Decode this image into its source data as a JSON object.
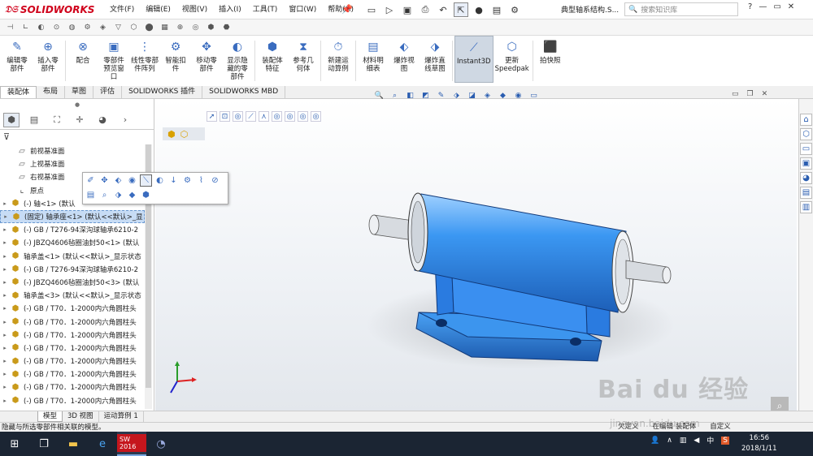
{
  "app": {
    "brand": "SOLIDWORKS",
    "doc_title": "典型轴系结构.S..."
  },
  "menu": [
    "文件(F)",
    "编辑(E)",
    "视图(V)",
    "插入(I)",
    "工具(T)",
    "窗口(W)",
    "帮助(H)"
  ],
  "search": {
    "placeholder": "搜索知识库"
  },
  "ribbon": [
    {
      "label": "编辑零\n部件",
      "icon": "edit-component-icon"
    },
    {
      "label": "插入零\n部件",
      "icon": "insert-component-icon"
    },
    {
      "label": "配合",
      "icon": "mate-icon"
    },
    {
      "label": "零部件\n预览窗\n口",
      "icon": "component-preview-icon"
    },
    {
      "label": "线性零部\n件阵列",
      "icon": "linear-pattern-icon"
    },
    {
      "label": "智能扣\n件",
      "icon": "smart-fastener-icon"
    },
    {
      "label": "移动零\n部件",
      "icon": "move-component-icon"
    },
    {
      "label": "显示隐\n藏的零\n部件",
      "icon": "show-hidden-icon"
    },
    {
      "label": "装配体\n特征",
      "icon": "assembly-feature-icon"
    },
    {
      "label": "参考几\n何体",
      "icon": "reference-geometry-icon"
    },
    {
      "label": "新建运\n动算例",
      "icon": "motion-study-icon"
    },
    {
      "label": "材料明\n细表",
      "icon": "bom-icon"
    },
    {
      "label": "爆炸视\n图",
      "icon": "exploded-view-icon"
    },
    {
      "label": "爆炸直\n线草图",
      "icon": "explode-line-icon"
    },
    {
      "label": "Instant3D",
      "icon": "instant3d-icon"
    },
    {
      "label": "更新\nSpeedpak",
      "icon": "speedpak-icon"
    },
    {
      "label": "拍快照",
      "icon": "snapshot-icon"
    }
  ],
  "cmd_tabs": [
    "装配体",
    "布局",
    "草图",
    "评估",
    "SOLIDWORKS 插件",
    "SOLIDWORKS MBD"
  ],
  "tree": [
    {
      "label": "前视基准面",
      "type": "plane",
      "expand": false
    },
    {
      "label": "上视基准面",
      "type": "plane",
      "expand": false
    },
    {
      "label": "右视基准面",
      "type": "plane",
      "expand": false
    },
    {
      "label": "原点",
      "type": "origin",
      "expand": false
    },
    {
      "label": "(-) 轴<1> (默认",
      "type": "part",
      "expand": true
    },
    {
      "label": "(固定) 轴承座<1> (默认<<默认>_显",
      "type": "part",
      "expand": true,
      "highlight": true
    },
    {
      "label": "(-) GB / T276-94深沟球轴承6210-2",
      "type": "part",
      "expand": true
    },
    {
      "label": "(-) JBZQ4606毡圈油封50<1> (默认",
      "type": "part",
      "expand": true
    },
    {
      "label": "轴承盖<1> (默认<<默认>_显示状态",
      "type": "part",
      "expand": true
    },
    {
      "label": "(-) GB / T276-94深沟球轴承6210-2",
      "type": "part",
      "expand": true
    },
    {
      "label": "(-) JBZQ4606毡圈油封50<3> (默认",
      "type": "part",
      "expand": true
    },
    {
      "label": "轴承盖<3> (默认<<默认>_显示状态",
      "type": "part",
      "expand": true
    },
    {
      "label": "(-) GB / T70．1-2000内六角圆柱头",
      "type": "part",
      "expand": true
    },
    {
      "label": "(-) GB / T70．1-2000内六角圆柱头",
      "type": "part",
      "expand": true
    },
    {
      "label": "(-) GB / T70．1-2000内六角圆柱头",
      "type": "part",
      "expand": true
    },
    {
      "label": "(-) GB / T70．1-2000内六角圆柱头",
      "type": "part",
      "expand": true
    },
    {
      "label": "(-) GB / T70．1-2000内六角圆柱头",
      "type": "part",
      "expand": true
    },
    {
      "label": "(-) GB / T70．1-2000内六角圆柱头",
      "type": "part",
      "expand": true
    },
    {
      "label": "(-) GB / T70．1-2000内六角圆柱头",
      "type": "part",
      "expand": true
    },
    {
      "label": "(-) GB / T70．1-2000内六角圆柱头",
      "type": "part",
      "expand": true
    }
  ],
  "bottom_tabs": [
    "模型",
    "3D 视图",
    "运动算例 1"
  ],
  "status": {
    "left": "隐藏与所选零部件相关联的模型。",
    "right": "欠定义　　在编辑 装配体　　自定义"
  },
  "taskbar": {
    "time": "16:56",
    "date": "2018/1/11",
    "ime": "中",
    "sw_badge": "SW 2016"
  },
  "watermark": {
    "text": "Bai du 经验",
    "sub": "jingyan.baidu.com"
  },
  "colors": {
    "part_blue": "#2f8cf0",
    "brand_red": "#d0021b"
  }
}
